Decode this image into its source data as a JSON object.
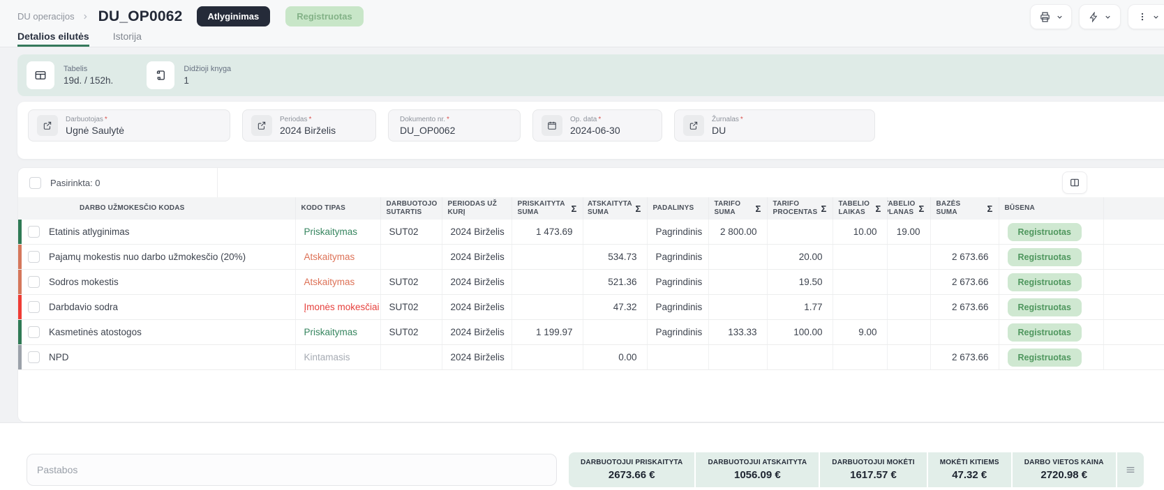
{
  "breadcrumb": {
    "parent": "DU operacijos",
    "current": "DU_OP0062"
  },
  "badges": {
    "type": "Atlyginimas",
    "status": "Registruotas"
  },
  "required_marker": "*",
  "tabs": [
    {
      "label": "Detalios eilutės",
      "active": true
    },
    {
      "label": "Istorija",
      "active": false
    }
  ],
  "toolbar_icons": [
    "printer-icon",
    "lightning-icon",
    "kebab-icon",
    "chevron-down-icon"
  ],
  "info_bar": [
    {
      "icon": "timesheet-table-icon",
      "label": "Tabelis",
      "value": "19d. / 152h."
    },
    {
      "icon": "ledger-scroll-icon",
      "label": "Didžioji knyga",
      "value": "1"
    }
  ],
  "fields": [
    {
      "label": "Darbuotojas",
      "value": "Ugnė Saulytė",
      "icon": "external-link-icon"
    },
    {
      "label": "Periodas",
      "value": "2024 Birželis",
      "icon": "external-link-icon"
    },
    {
      "label": "Dokumento nr.",
      "value": "DU_OP0062",
      "icon": null
    },
    {
      "label": "Op. data",
      "value": "2024-06-30",
      "icon": "calendar-icon"
    },
    {
      "label": "Žurnalas",
      "value": "DU",
      "icon": "external-link-icon"
    }
  ],
  "table": {
    "selected_label": "Pasirinkta: 0",
    "sigma": "Σ",
    "columns": [
      {
        "key": "name",
        "label": "DARBO UŽMOKESČIO KODAS",
        "sum": false
      },
      {
        "key": "kodo_tipas",
        "label": "KODO TIPAS",
        "sum": false
      },
      {
        "key": "sutartis",
        "label": "DARBUOTOJO SUTARTIS",
        "sum": false
      },
      {
        "key": "periodas",
        "label": "PERIODAS UŽ KURĮ",
        "sum": false
      },
      {
        "key": "priskaityta",
        "label": "PRISKAITYTA SUMA",
        "sum": true
      },
      {
        "key": "atskaityta",
        "label": "ATSKAITYTA SUMA",
        "sum": true
      },
      {
        "key": "padalinys",
        "label": "PADALINYS",
        "sum": false
      },
      {
        "key": "tarifo_suma",
        "label": "TARIFO SUMA",
        "sum": true
      },
      {
        "key": "tarifo_procentas",
        "label": "TARIFO PROCENTAS",
        "sum": true
      },
      {
        "key": "tabelio_laikas",
        "label": "TABELIO LAIKAS",
        "sum": true
      },
      {
        "key": "tabelio_planas",
        "label": "TABELIO PLANAS",
        "sum": true
      },
      {
        "key": "bazes_suma",
        "label": "BAZĖS SUMA",
        "sum": true
      },
      {
        "key": "busena",
        "label": "BŪSENA",
        "sum": false
      }
    ],
    "rows": [
      {
        "color": "green",
        "name": "Etatinis atlyginimas",
        "kodo_tipas": "Priskaitymas",
        "tipas_color": "green",
        "sutartis": "SUT02",
        "periodas": "2024 Birželis",
        "priskaityta": "1 473.69",
        "atskaityta": "",
        "padalinys": "Pagrindinis",
        "tarifo_suma": "2 800.00",
        "tarifo_procentas": "",
        "tabelio_laikas": "10.00",
        "tabelio_planas": "19.00",
        "bazes_suma": "",
        "busena": "Registruotas"
      },
      {
        "color": "salmon",
        "name": "Pajamų mokestis nuo darbo užmokesčio (20%)",
        "kodo_tipas": "Atskaitymas",
        "tipas_color": "salmon",
        "sutartis": "",
        "periodas": "2024 Birželis",
        "priskaityta": "",
        "atskaityta": "534.73",
        "padalinys": "Pagrindinis",
        "tarifo_suma": "",
        "tarifo_procentas": "20.00",
        "tabelio_laikas": "",
        "tabelio_planas": "",
        "bazes_suma": "2 673.66",
        "busena": "Registruotas"
      },
      {
        "color": "salmon",
        "name": "Sodros mokestis",
        "kodo_tipas": "Atskaitymas",
        "tipas_color": "salmon",
        "sutartis": "SUT02",
        "periodas": "2024 Birželis",
        "priskaityta": "",
        "atskaityta": "521.36",
        "padalinys": "Pagrindinis",
        "tarifo_suma": "",
        "tarifo_procentas": "19.50",
        "tabelio_laikas": "",
        "tabelio_planas": "",
        "bazes_suma": "2 673.66",
        "busena": "Registruotas"
      },
      {
        "color": "red",
        "name": "Darbdavio sodra",
        "kodo_tipas": "Įmonės mokesčiai",
        "tipas_color": "red",
        "sutartis": "SUT02",
        "periodas": "2024 Birželis",
        "priskaityta": "",
        "atskaityta": "47.32",
        "padalinys": "Pagrindinis",
        "tarifo_suma": "",
        "tarifo_procentas": "1.77",
        "tabelio_laikas": "",
        "tabelio_planas": "",
        "bazes_suma": "2 673.66",
        "busena": "Registruotas"
      },
      {
        "color": "green",
        "name": "Kasmetinės atostogos",
        "kodo_tipas": "Priskaitymas",
        "tipas_color": "green",
        "sutartis": "SUT02",
        "periodas": "2024 Birželis",
        "priskaityta": "1 199.97",
        "atskaityta": "",
        "padalinys": "Pagrindinis",
        "tarifo_suma": "133.33",
        "tarifo_procentas": "100.00",
        "tabelio_laikas": "9.00",
        "tabelio_planas": "",
        "bazes_suma": "",
        "busena": "Registruotas"
      },
      {
        "color": "gray",
        "name": "NPD",
        "kodo_tipas": "Kintamasis",
        "tipas_color": "gray",
        "sutartis": "",
        "periodas": "2024 Birželis",
        "priskaityta": "",
        "atskaityta": "0.00",
        "padalinys": "",
        "tarifo_suma": "",
        "tarifo_procentas": "",
        "tabelio_laikas": "",
        "tabelio_planas": "",
        "bazes_suma": "2 673.66",
        "busena": "Registruotas"
      }
    ]
  },
  "notes": {
    "placeholder": "Pastabos"
  },
  "summary": {
    "items": [
      {
        "label": "DARBUOTOJUI PRISKAITYTA",
        "value": "2673.66 €"
      },
      {
        "label": "DARBUOTOJUI ATSKAITYTA",
        "value": "1056.09 €"
      },
      {
        "label": "DARBUOTOJUI MOKĖTI",
        "value": "1617.57 €"
      },
      {
        "label": "MOKĖTI KITIEMS",
        "value": "47.32 €"
      },
      {
        "label": "DARBO VIETOS KAINA",
        "value": "2720.98 €"
      }
    ],
    "menu_icon": "hamburger-icon"
  },
  "colors": {
    "green": "#2f7a55",
    "salmon": "#d5775b",
    "red": "#ef3c35",
    "gray": "#9ba1a9",
    "type_green": "#36855f",
    "type_salmon": "#dd7257",
    "type_red": "#e6403c",
    "type_gray": "#a6abb3",
    "status_badge_bg": "#cfe8d1",
    "status_badge_text": "#4f975e",
    "accent_green": "#35795b",
    "mint": "#dfebe7",
    "badge_dark": "#252b39",
    "badge_light_bg": "#c8e6c8"
  }
}
